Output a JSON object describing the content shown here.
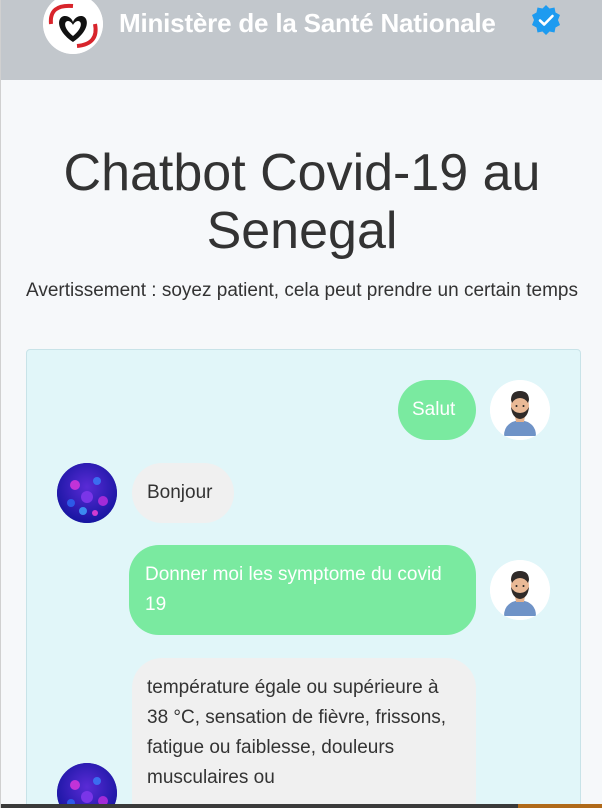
{
  "header": {
    "title": "Ministère de la Santé Nationale",
    "logo_icon": "heart-logo-icon",
    "verified_icon": "verified-badge-icon",
    "verified_color": "#1d9bf0"
  },
  "main": {
    "title": "Chatbot Covid-19 au Senegal",
    "warning": "Avertissement : soyez patient, cela peut prendre un certain temps"
  },
  "chat": {
    "colors": {
      "user_bubble": "#7aeaa0",
      "bot_bubble": "#f0f0f0",
      "panel": "#e1f6f9"
    },
    "messages": [
      {
        "sender": "user",
        "text": "Salut"
      },
      {
        "sender": "bot",
        "text": "Bonjour"
      },
      {
        "sender": "user",
        "text": "Donner moi les symptome du covid 19"
      },
      {
        "sender": "bot",
        "text": "température égale ou supérieure à 38 °C, sensation de fièvre, frissons, fatigue ou faiblesse, douleurs musculaires ou"
      }
    ]
  }
}
